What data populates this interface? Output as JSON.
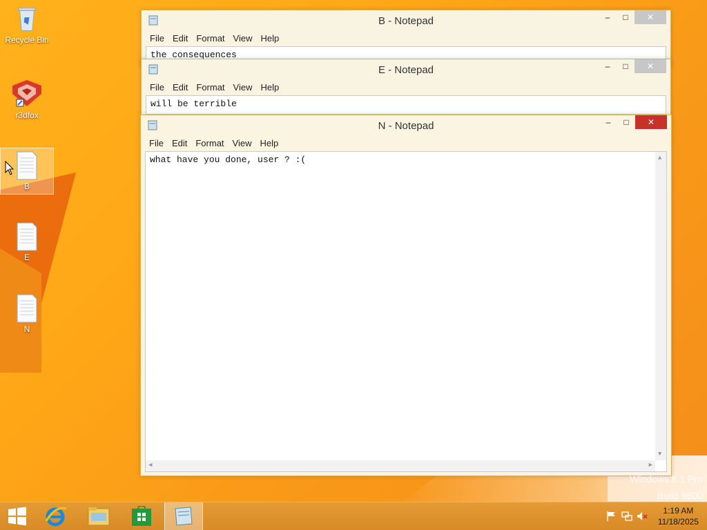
{
  "desktop": {
    "icons": [
      {
        "label": "Recycle Bin"
      },
      {
        "label": "r3dfox"
      },
      {
        "label": "B"
      },
      {
        "label": "E"
      },
      {
        "label": "N"
      }
    ],
    "watermark": {
      "line1": "Windows 8.1 Pro",
      "line2": "Build 9600"
    }
  },
  "windows": [
    {
      "title": "B - Notepad",
      "content": "the consequences"
    },
    {
      "title": "E - Notepad",
      "content": "will be terrible"
    },
    {
      "title": "N - Notepad",
      "content": "what have you done, user ? :("
    }
  ],
  "menu": {
    "file": "File",
    "edit": "Edit",
    "format": "Format",
    "view": "View",
    "help": "Help"
  },
  "controls": {
    "minimize": "–",
    "maximize": "□",
    "close": "✕"
  },
  "taskbar": {
    "items": [
      "start",
      "internet-explorer",
      "file-explorer",
      "store",
      "notepad"
    ],
    "clock": {
      "time": "1:19 AM",
      "date": "11/18/2025"
    }
  },
  "colors": {
    "accent": "#ffa617",
    "close_active": "#c7312a",
    "window_frame": "#f9f3e2"
  }
}
